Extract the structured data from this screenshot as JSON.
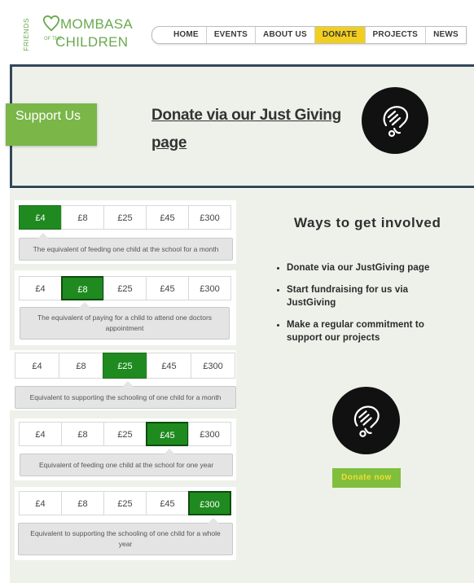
{
  "logo": {
    "friends": "FRIENDS",
    "mombasa": "MOMBASA",
    "children": "CHILDREN",
    "in_the": "OF THE"
  },
  "nav": {
    "items": [
      {
        "label": "HOME",
        "active": false
      },
      {
        "label": "EVENTS",
        "active": false
      },
      {
        "label": "ABOUT US",
        "active": false
      },
      {
        "label": "DONATE",
        "active": true
      },
      {
        "label": "PROJECTS",
        "active": false
      },
      {
        "label": "NEWS",
        "active": false
      }
    ]
  },
  "hero": {
    "support_label": "Support Us",
    "donate_link": "Donate via our Just Giving page",
    "icon": "justgiving-hand-icon"
  },
  "amounts": {
    "options": [
      "£4",
      "£8",
      "£25",
      "£45",
      "£300"
    ],
    "cards": [
      {
        "selected": "£4",
        "description": "The equivalent of feeding one child at the school for a month"
      },
      {
        "selected": "£8",
        "description": "The equivalent of paying for a child to attend one doctors appointment"
      },
      {
        "selected": "£25",
        "description": "Equivalent to supporting the schooling of one child for a month"
      },
      {
        "selected": "£45",
        "description": "Equivalent of feeding one child at the school for one year"
      },
      {
        "selected": "£300",
        "description": "Equivalent to supporting the schooling of one child for a whole year"
      }
    ]
  },
  "ways": {
    "title": "Ways to get involved",
    "items": [
      "Donate via our JustGiving page",
      "Start fundraising for us via JustGiving",
      "Make a regular commitment to support our projects"
    ]
  },
  "donate_button": "Donate now",
  "colors": {
    "brand_green": "#6aa84f",
    "selected_green": "#1f8a1f",
    "nav_active": "#f2cf1e",
    "button_green": "#80bf3d",
    "button_text": "#f2dc2f",
    "hero_border": "#33475b"
  }
}
